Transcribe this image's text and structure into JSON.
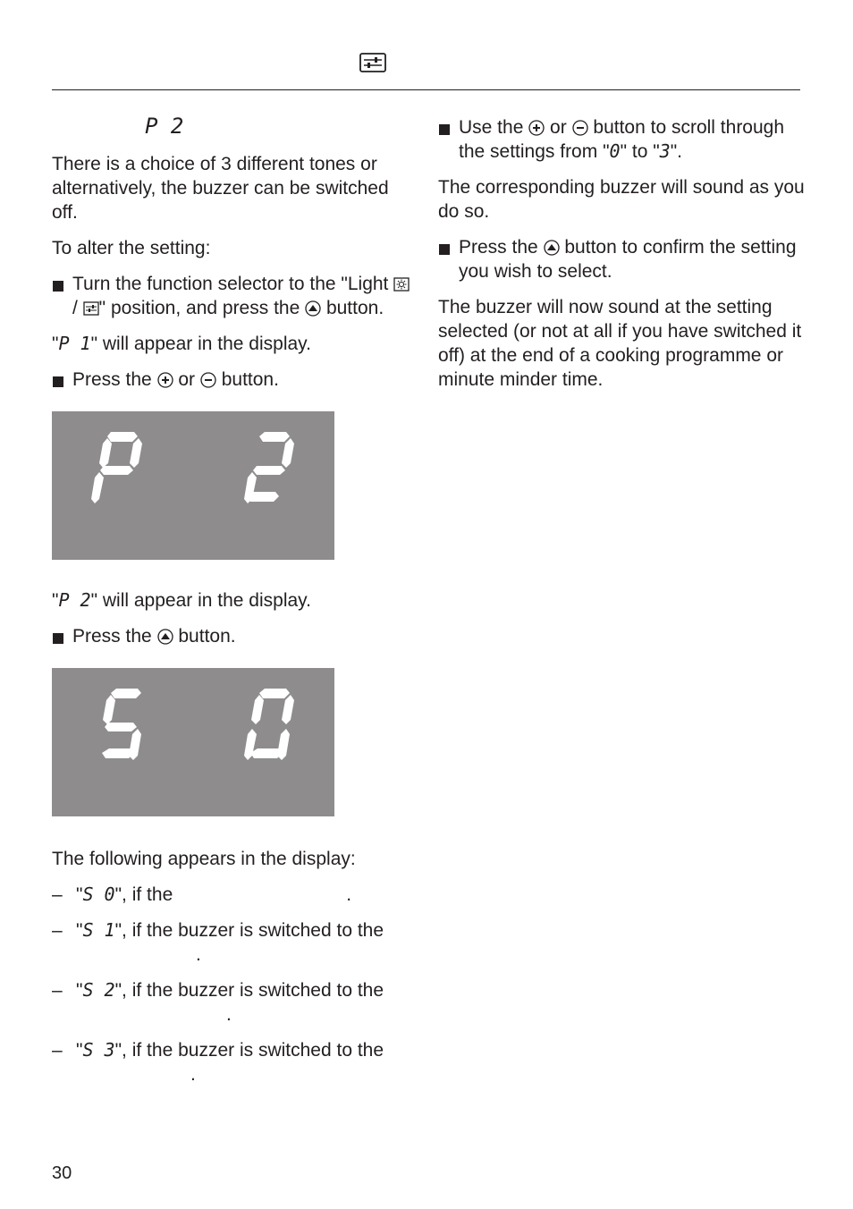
{
  "header": {
    "icon": "settings-sliders-icon"
  },
  "left": {
    "heading_code": "P 2",
    "intro": "There is a choice of 3 different tones or alternatively, the buzzer can be switched off.",
    "to_alter": "To alter the setting:",
    "step1": {
      "part1": "Turn the function selector to the \"Light ",
      "part2": " / ",
      "part3": "\" position, and press the ",
      "part4": " button."
    },
    "p1_open": "\"",
    "p1_code": "P 1",
    "p1_rest": "\" will appear in the display.",
    "step2": {
      "part1": "Press the ",
      "part2": " or ",
      "part3": " button."
    },
    "display1": {
      "left_char": "P",
      "right_char": "2"
    },
    "p2_open": "\"",
    "p2_code": "P 2",
    "p2_rest": "\" will appear in the display.",
    "step3": {
      "part1": "Press the ",
      "part2": " button."
    },
    "display2": {
      "left_char": "S",
      "right_char": "0"
    },
    "following": "The following appears in the display:",
    "items": [
      {
        "dash": "–",
        "code": "S 0",
        "pre": "\"",
        "post": "\", if the",
        "end": "."
      },
      {
        "dash": "–",
        "code": "S 1",
        "pre": "\"",
        "post": "\", if the buzzer is switched to the",
        "end": "."
      },
      {
        "dash": "–",
        "code": "S 2",
        "pre": "\"",
        "post": "\", if the buzzer is switched to the",
        "end": "."
      },
      {
        "dash": "–",
        "code": "S 3",
        "pre": "\"",
        "post": "\", if the buzzer is switched to the",
        "end": "."
      }
    ]
  },
  "right": {
    "step1": {
      "part1": "Use the ",
      "part2": " or ",
      "part3": " button to scroll through the settings from \"",
      "code_from": "0",
      "part4": "\" to \"",
      "code_to": "3",
      "part5": "\"."
    },
    "corresponding": "The corresponding buzzer will sound as you do so.",
    "step2": {
      "part1": "Press the ",
      "part2": " button to confirm the setting you wish to select."
    },
    "final": "The buzzer will now sound at the setting selected (or not at all if you have switched it off) at the end of a cooking programme or minute minder time."
  },
  "footer": {
    "page_number": "30"
  }
}
